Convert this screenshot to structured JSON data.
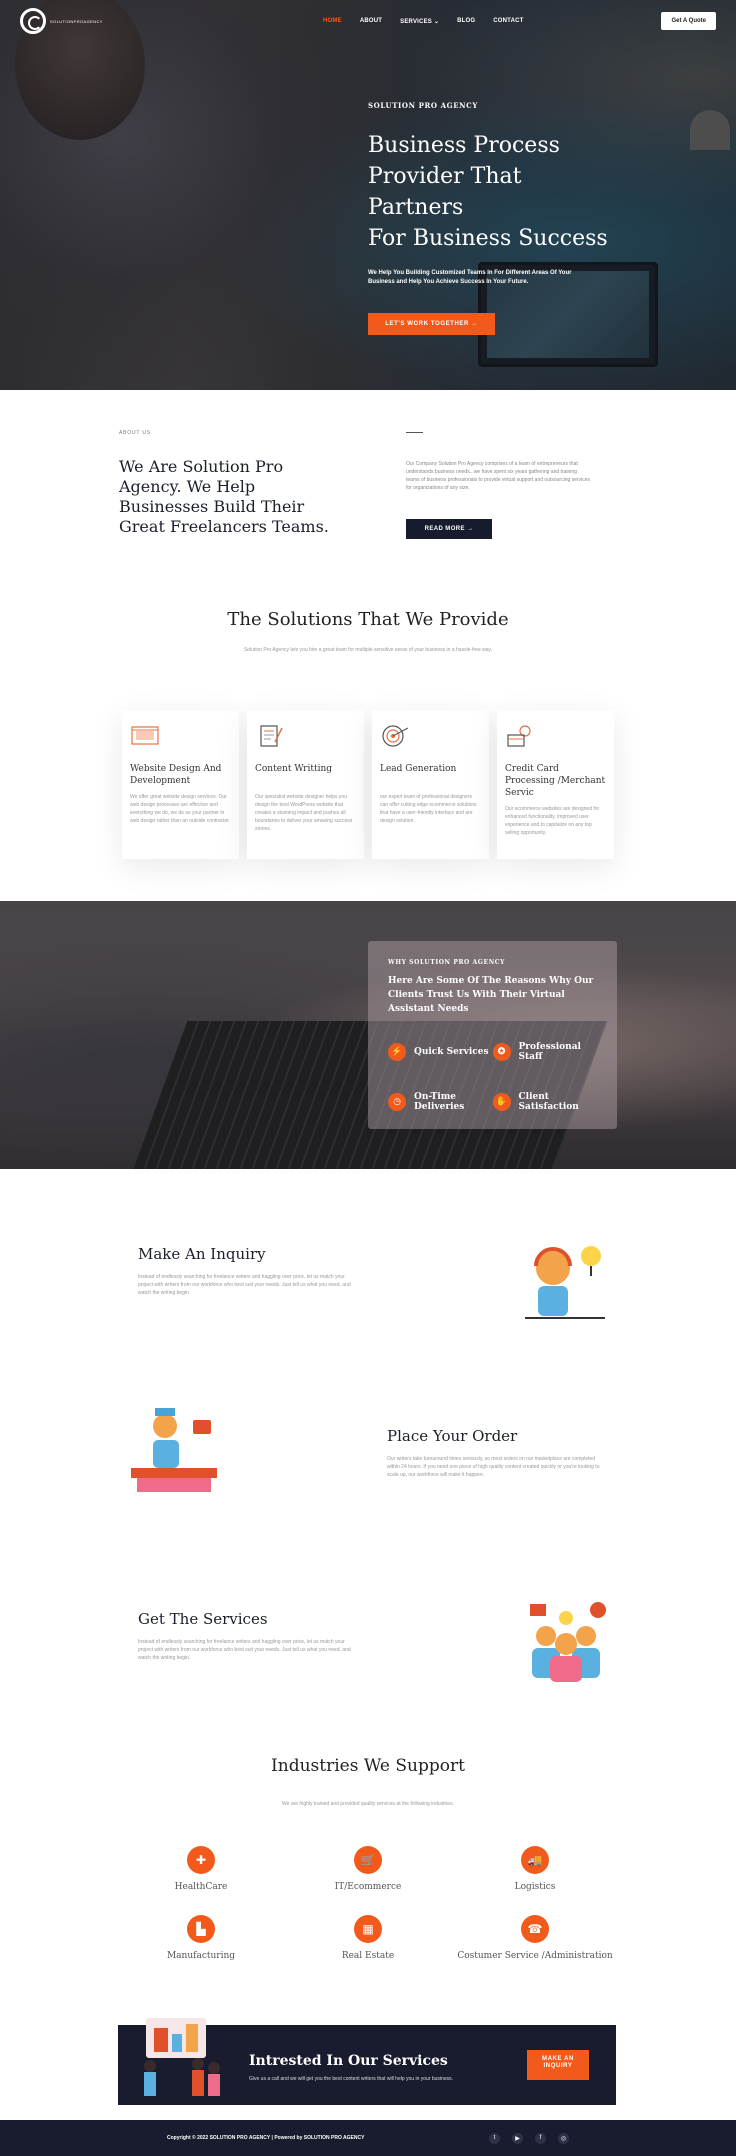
{
  "nav": {
    "logo_text": "SOLUTIONPROAGENCY",
    "items": [
      {
        "label": "HOME",
        "active": true
      },
      {
        "label": "ABOUT",
        "active": false
      },
      {
        "label": "SERVICES ⌄",
        "active": false
      },
      {
        "label": "BLOG",
        "active": false
      },
      {
        "label": "CONTACT",
        "active": false
      }
    ],
    "cta": "Get A Quote"
  },
  "hero": {
    "eyebrow": "SOLUTION PRO AGENCY",
    "title_lines": [
      "Business Process",
      "Provider That Partners",
      "For Business Success"
    ],
    "subtitle": "We Help You Building Customized Teams In For Different Areas Of Your Business and Help You Achieve Success In Your Future.",
    "button": "LET'S WORK TOGETHER →"
  },
  "about": {
    "label": "ABOUT US",
    "title": "We Are Solution Pro Agency. We Help Businesses Build Their Great Freelancers Teams.",
    "description": "Our Company Solution Pro Agency comprises of a team of entrepreneurs that understands business needs...we have spent six years gathering and training teams of business professionals to provide virtual support and outsourcing services for organizations of any size.",
    "button": "READ MORE →"
  },
  "solutions": {
    "title": "The Solutions That We Provide",
    "subtitle": "Solution Pro Agency lets you hire a great team for multiple sensitive areas of your business in a hassle-free way.",
    "cards": [
      {
        "icon": "web-design-icon",
        "title": "Website Design And Development",
        "text": "We offer great website design services. Our web design processes are effective and everything we do, we do as your partner in web design rather than an outside contractor."
      },
      {
        "icon": "content-writing-icon",
        "title": "Content Writting",
        "text": "Our specialist website designer helps you design the best WordPress website that creates a stunning impact and pushes all boundaries to deliver your amazing success stories."
      },
      {
        "icon": "lead-target-icon",
        "title": "Lead Generation",
        "text": "our expert team of professional designers can offer cutting edge ecommerce solutions that have a user-friendly interface and are design solution."
      },
      {
        "icon": "credit-card-icon",
        "title": "Credit Card Processing /Merchant Servic",
        "text": "Our ecommerce websites are designed for enhanced functionality, improved user experience and to capitalize on any top selling opportunity."
      }
    ]
  },
  "why": {
    "eyebrow": "WHY SOLUTION PRO AGENCY",
    "title": "Here Are Some Of The Reasons Why Our Clients Trust Us With Their Virtual Assistant Needs",
    "features": [
      {
        "icon": "lightning-icon",
        "label": "Quick Services"
      },
      {
        "icon": "medal-icon",
        "label": "Professional Staff"
      },
      {
        "icon": "clock-icon",
        "label": "On-Time Deliveries"
      },
      {
        "icon": "handshake-icon",
        "label": "Client Satisfaction"
      }
    ]
  },
  "steps": [
    {
      "title": "Make An Inquiry",
      "text": "Instead of endlessly searching for freelance writers and haggling over price, let us match your project with writers from our workforce who best suit your needs. Just tell us what you need, and watch the writing begin."
    },
    {
      "title": "Place Your Order",
      "text": "Our writers take turnaround times seriously, so most orders on our marketplace are completed within 24 hours. If you need one piece of high quality content created quickly or you're looking to scale up, our workforce will make it happen."
    },
    {
      "title": "Get The Services",
      "text": "Instead of endlessly searching for freelance writers and haggling over price, let us match your project with writers from our workforce who best suit your needs. Just tell us what you need, and watch the writing begin."
    }
  ],
  "industries": {
    "title": "Industries We Support",
    "subtitle": "We are highly trained and provided quality services at the following industries.",
    "items": [
      {
        "icon": "medical-kit-icon",
        "label": "HealthCare"
      },
      {
        "icon": "cart-icon",
        "label": "IT/Ecommerce"
      },
      {
        "icon": "truck-icon",
        "label": "Logistics"
      },
      {
        "icon": "factory-icon",
        "label": "Manufacturing"
      },
      {
        "icon": "building-icon",
        "label": "Real Estate"
      },
      {
        "icon": "headset-icon",
        "label": "Costumer Service /Administration"
      }
    ]
  },
  "cta": {
    "title": "Intrested In Our Services",
    "text": "Give us a call and we will get you the best content writers that will help you in your business.",
    "button": "MAKE AN INQUIRY"
  },
  "footer": {
    "copyright": "Copyright © 2022 SOLUTION PRO AGENCY | Powered by SOLUTION PRO AGENCY",
    "socials": [
      "twitter-icon",
      "youtube-icon",
      "facebook-icon",
      "instagram-icon"
    ]
  },
  "colors": {
    "accent": "#f25a1c",
    "dark": "#181c2e"
  }
}
